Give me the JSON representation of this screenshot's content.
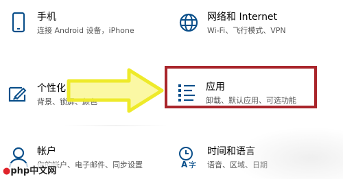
{
  "settings": {
    "phone": {
      "title": "手机",
      "subtitle": "连接 Android 设备，iPhone",
      "icon": "phone-icon"
    },
    "network": {
      "title": "网络和 Internet",
      "subtitle": "Wi-Fi、飞行模式、VPN",
      "icon": "globe-icon"
    },
    "personalize": {
      "title": "个性化",
      "subtitle": "背景、锁屏、颜色",
      "icon": "paint-brush-icon"
    },
    "apps": {
      "title": "应用",
      "subtitle": "卸载、默认应用、可选功能",
      "icon": "apps-list-icon"
    },
    "accounts": {
      "title": "帐户",
      "subtitle": "你的帐户、电子邮件、同步设置",
      "icon": "person-icon"
    },
    "time": {
      "title": "时间和语言",
      "subtitle": "语音、区域、日期",
      "icon": "time-language-icon"
    }
  },
  "colors": {
    "accent": "#0a4f8a",
    "highlight_border": "#a9252b",
    "arrow_fill": "#f7f25a"
  },
  "watermark": {
    "text": "php中文网"
  }
}
